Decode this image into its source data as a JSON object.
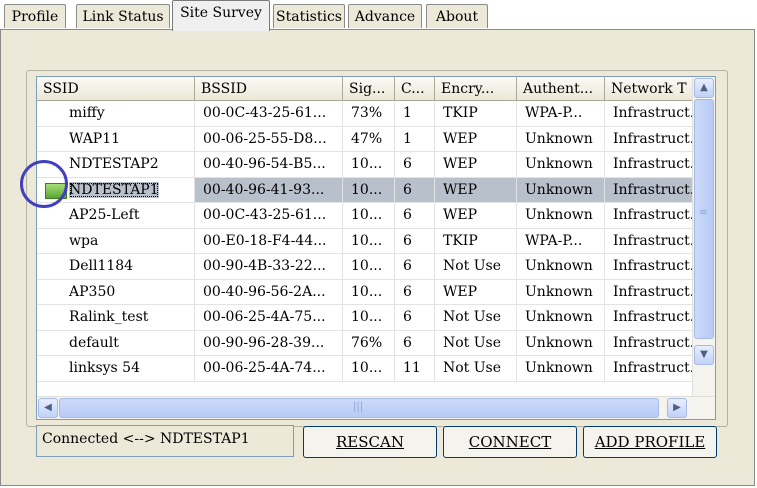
{
  "tabs": [
    "Profile",
    "Link Status",
    "Site Survey",
    "Statistics",
    "Advance",
    "About"
  ],
  "active_tab": "Site Survey",
  "columns": [
    "SSID",
    "BSSID",
    "Sig...",
    "C...",
    "Encry...",
    "Authent...",
    "Network T"
  ],
  "rows": [
    {
      "ssid": "miffy",
      "bssid": "00-0C-43-25-61...",
      "signal": "73%",
      "channel": "1",
      "encryption": "TKIP",
      "auth": "WPA-P...",
      "network": "Infrastruct."
    },
    {
      "ssid": "WAP11",
      "bssid": "00-06-25-55-D8...",
      "signal": "47%",
      "channel": "1",
      "encryption": "WEP",
      "auth": "Unknown",
      "network": "Infrastruct."
    },
    {
      "ssid": "NDTESTAP2",
      "bssid": "00-40-96-54-B5...",
      "signal": "10...",
      "channel": "6",
      "encryption": "WEP",
      "auth": "Unknown",
      "network": "Infrastruct."
    },
    {
      "ssid": "NDTESTAP1",
      "bssid": "00-40-96-41-93...",
      "signal": "10...",
      "channel": "6",
      "encryption": "WEP",
      "auth": "Unknown",
      "network": "Infrastruct.",
      "selected": true
    },
    {
      "ssid": "AP25-Left",
      "bssid": "00-0C-43-25-61...",
      "signal": "10...",
      "channel": "6",
      "encryption": "WEP",
      "auth": "Unknown",
      "network": "Infrastruct."
    },
    {
      "ssid": "wpa",
      "bssid": "00-E0-18-F4-44...",
      "signal": "10...",
      "channel": "6",
      "encryption": "TKIP",
      "auth": "WPA-P...",
      "network": "Infrastruct."
    },
    {
      "ssid": "Dell1184",
      "bssid": "00-90-4B-33-22...",
      "signal": "10...",
      "channel": "6",
      "encryption": "Not Use",
      "auth": "Unknown",
      "network": "Infrastruct."
    },
    {
      "ssid": "AP350",
      "bssid": "00-40-96-56-2A...",
      "signal": "10...",
      "channel": "6",
      "encryption": "WEP",
      "auth": "Unknown",
      "network": "Infrastruct."
    },
    {
      "ssid": "Ralink_test",
      "bssid": "00-06-25-4A-75...",
      "signal": "10...",
      "channel": "6",
      "encryption": "Not Use",
      "auth": "Unknown",
      "network": "Infrastruct."
    },
    {
      "ssid": "default",
      "bssid": "00-90-96-28-39...",
      "signal": "76%",
      "channel": "6",
      "encryption": "Not Use",
      "auth": "Unknown",
      "network": "Infrastruct."
    },
    {
      "ssid": "linksys 54",
      "bssid": "00-06-25-4A-74...",
      "signal": "10...",
      "channel": "11",
      "encryption": "Not Use",
      "auth": "Unknown",
      "network": "Infrastruct."
    }
  ],
  "status_text": "Connected <--> NDTESTAP1",
  "buttons": {
    "rescan": "RESCAN",
    "connect": "CONNECT",
    "add_profile": "ADD PROFILE"
  },
  "icons": {
    "connected": "connected-network-icon",
    "scroll_up": "scroll-up-arrow-icon",
    "scroll_down": "scroll-down-arrow-icon",
    "scroll_left": "scroll-left-arrow-icon",
    "scroll_right": "scroll-right-arrow-icon"
  },
  "colors": {
    "selected_row": "#b8c0cc",
    "annotation_circle": "#4040c0"
  }
}
